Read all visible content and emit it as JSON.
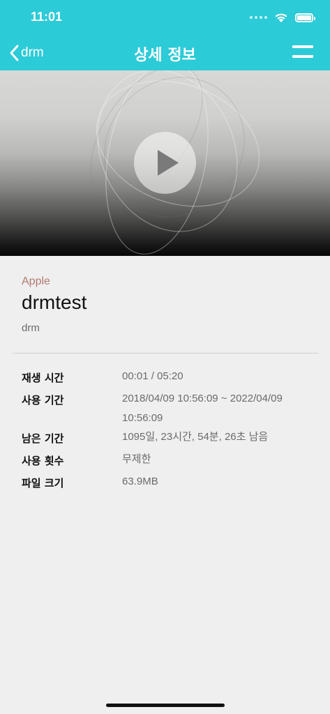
{
  "status_bar": {
    "time": "11:01"
  },
  "nav": {
    "back_label": "drm",
    "title": "상세 정보",
    "menu_icon": "hamburger-icon"
  },
  "video": {
    "play_icon": "play-icon"
  },
  "content": {
    "vendor": "Apple",
    "title": "drmtest",
    "subtitle": "drm"
  },
  "details": [
    {
      "label": "재생 시간",
      "value": "00:01 / 05:20"
    },
    {
      "label": "사용 기간",
      "value": "2018/04/09 10:56:09 ~ 2022/04/09 10:56:09"
    },
    {
      "label": "남은 기간",
      "value": "1095일, 23시간, 54분, 26초 남음"
    },
    {
      "label": "사용 횟수",
      "value": "무제한"
    },
    {
      "label": "파일 크기",
      "value": "63.9MB"
    }
  ],
  "colors": {
    "header": "#2ccbd8",
    "background": "#efefef",
    "vendor_text": "#b07a70"
  }
}
